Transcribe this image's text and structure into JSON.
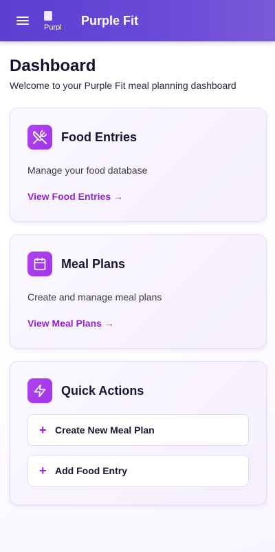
{
  "header": {
    "brand": "Purple Fit",
    "logo_alt": "Purpl",
    "icons": {
      "menu": "hamburger-menu-icon",
      "logo": "broken-image-icon"
    }
  },
  "page": {
    "title": "Dashboard",
    "subtitle": "Welcome to your Purple Fit meal planning dashboard"
  },
  "cards": [
    {
      "title": "Food Entries",
      "description": "Manage your food database",
      "link": "View Food Entries →",
      "icon": "utensils-crossed-icon"
    },
    {
      "title": "Meal Plans",
      "description": "Create and manage meal plans",
      "link": "View Meal Plans →",
      "icon": "calendar-icon"
    }
  ],
  "quick_actions": {
    "title": "Quick Actions",
    "icon": "lightning-icon",
    "actions": [
      {
        "label": "Create New Meal Plan",
        "icon": "plus-icon"
      },
      {
        "label": "Add Food Entry",
        "icon": "plus-icon"
      }
    ]
  },
  "colors": {
    "accent": "#9a1ee0",
    "header": "#5b3fd0",
    "icon_bg": "#b042f0"
  }
}
